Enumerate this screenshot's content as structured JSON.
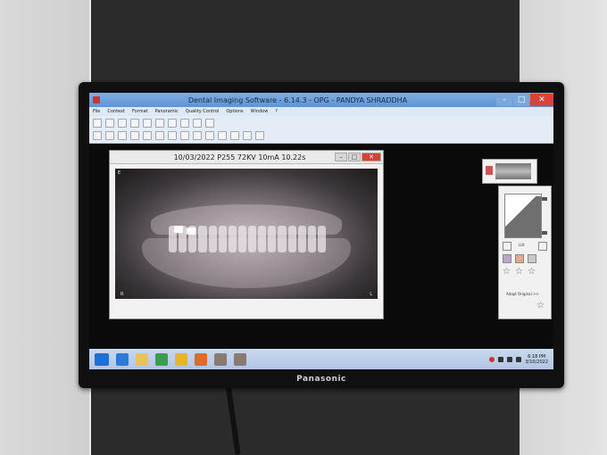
{
  "window": {
    "title": "Dental Imaging Software - 6.14.3 - OPG - PANDYA SHRADDHA",
    "min": "–",
    "max": "□",
    "close": "✕"
  },
  "menu": [
    "File",
    "Context",
    "Format",
    "Panoramic",
    "Quality Control",
    "Options",
    "Window",
    "?"
  ],
  "image_window": {
    "title": "10/03/2022 P255 72KV 10mA 10.22s",
    "min": "–",
    "max": "□",
    "close": "✕",
    "corner_top_left": "E",
    "corner_bottom_left": "R",
    "corner_bottom_right": "L"
  },
  "side_panel": {
    "adapt_label": "Adapt Original >>",
    "lut_label": "LUt"
  },
  "brand": "Panasonic",
  "taskbar": {
    "time": "6:18 PM",
    "date": "3/10/2022",
    "apps": [
      {
        "name": "edge-icon",
        "color": "#2a7bd8"
      },
      {
        "name": "file-explorer-icon",
        "color": "#e8c25a"
      },
      {
        "name": "store-icon",
        "color": "#3b9b4f"
      },
      {
        "name": "chrome-icon",
        "color": "#e7b52a"
      },
      {
        "name": "firefox-icon",
        "color": "#e06a2a"
      },
      {
        "name": "app-icon-1",
        "color": "#8a7a6f"
      },
      {
        "name": "app-icon-2",
        "color": "#8a7a6f"
      }
    ]
  },
  "colors": {
    "titlebar": "#6a9bd8",
    "close": "#d9443a",
    "taskbar": "#bfd0ea"
  }
}
